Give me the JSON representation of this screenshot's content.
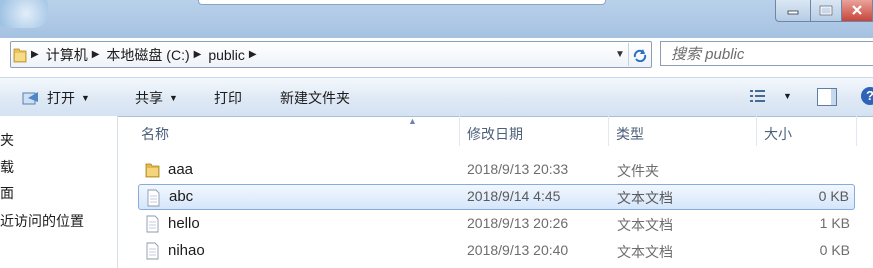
{
  "address": {
    "crumbs": [
      "计算机",
      "本地磁盘 (C:)",
      "public"
    ],
    "icon": "folder-icon"
  },
  "search": {
    "placeholder": "搜索 public"
  },
  "toolbar": {
    "open_label": "打开",
    "share_label": "共享",
    "print_label": "打印",
    "new_folder_label": "新建文件夹",
    "help_label": "?"
  },
  "nav": {
    "items": [
      "夹",
      "载",
      "面",
      "近访问的位置"
    ]
  },
  "columns": {
    "name": "名称",
    "modified": "修改日期",
    "type": "类型",
    "size": "大小"
  },
  "files": [
    {
      "name": "aaa",
      "modified": "2018/9/13 20:33",
      "type": "文件夹",
      "size": "",
      "icon": "folder-icon",
      "selected": false
    },
    {
      "name": "abc",
      "modified": "2018/9/14 4:45",
      "type": "文本文档",
      "size": "0 KB",
      "icon": "text-file-icon",
      "selected": true
    },
    {
      "name": "hello",
      "modified": "2018/9/13 20:26",
      "type": "文本文档",
      "size": "1 KB",
      "icon": "text-file-icon",
      "selected": false
    },
    {
      "name": "nihao",
      "modified": "2018/9/13 20:40",
      "type": "文本文档",
      "size": "0 KB",
      "icon": "text-file-icon",
      "selected": false
    }
  ],
  "colors": {
    "selection_border": "#84acdd",
    "selection_fill": "#d5e6fb",
    "help_blue": "#2f63b8"
  }
}
